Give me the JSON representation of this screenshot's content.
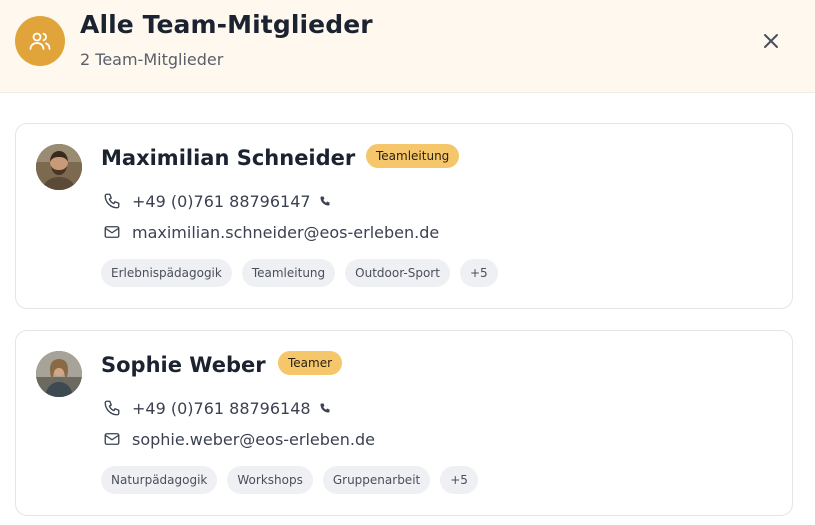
{
  "header": {
    "title": "Alle Team-Mitglieder",
    "subtitle": "2 Team-Mitglieder",
    "icon": "users-icon",
    "close_icon": "close-icon",
    "accent_color": "#e0a43a"
  },
  "members": [
    {
      "name": "Maximilian Schneider",
      "role": "Teamleitung",
      "phone": "+49 (0)761 88796147",
      "email": "maximilian.schneider@eos-erleben.de",
      "tags": [
        "Erlebnispädagogik",
        "Teamleitung",
        "Outdoor-Sport",
        "+5"
      ]
    },
    {
      "name": "Sophie Weber",
      "role": "Teamer",
      "phone": "+49 (0)761 88796148",
      "email": "sophie.weber@eos-erleben.de",
      "tags": [
        "Naturpädagogik",
        "Workshops",
        "Gruppenarbeit",
        "+5"
      ]
    }
  ]
}
